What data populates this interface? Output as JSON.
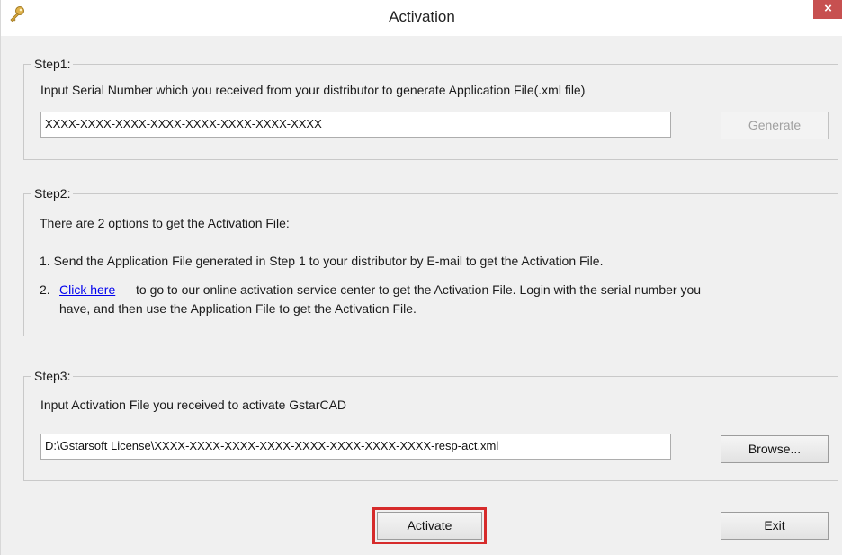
{
  "window": {
    "title": "Activation",
    "icon": "key-icon",
    "close_label": "×"
  },
  "step1": {
    "label": "Step1:",
    "instruction": "Input Serial Number which you received from your distributor to generate Application File(.xml file)",
    "serial_value": "XXXX-XXXX-XXXX-XXXX-XXXX-XXXX-XXXX-XXXX",
    "generate_label": "Generate"
  },
  "step2": {
    "label": "Step2:",
    "intro": "There are 2 options to get the Activation File:",
    "option1": "1.  Send the Application File generated in Step 1 to your distributor by E-mail to get the Activation File.",
    "option2_num": "2.",
    "option2_link": "Click here",
    "option2_text_line1": "to go to our online activation service center to get the Activation File. Login with the serial number you",
    "option2_text_line2": "have, and then use the Application File to get the Activation File."
  },
  "step3": {
    "label": "Step3:",
    "instruction": "Input Activation File you received to activate GstarCAD",
    "file_value": "D:\\Gstarsoft License\\XXXX-XXXX-XXXX-XXXX-XXXX-XXXX-XXXX-XXXX-resp-act.xml",
    "browse_label": "Browse..."
  },
  "footer": {
    "activate_label": "Activate",
    "exit_label": "Exit"
  },
  "colors": {
    "highlight": "#d62b2b",
    "link": "#0000ee",
    "close": "#c75050"
  }
}
